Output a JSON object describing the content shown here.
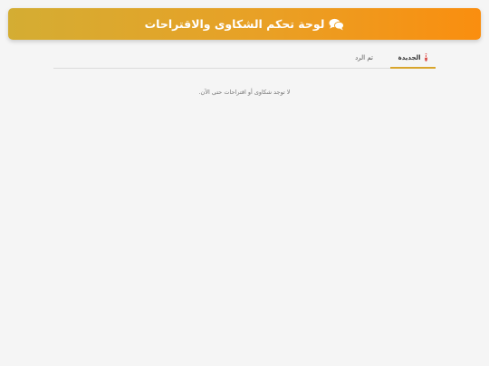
{
  "header": {
    "title": "لوحة تحكم الشكاوى والاقتراحات",
    "icon": "comments-icon",
    "gradient_start": "#d4ad33",
    "gradient_end": "#fa8e0f"
  },
  "tabs": [
    {
      "label": "الجديدة",
      "badge": "0",
      "active": true
    },
    {
      "label": "تم الرد",
      "active": false
    }
  ],
  "empty_state": {
    "message": "لا توجد شكاوى أو اقتراحات حتى الآن."
  },
  "colors": {
    "badge": "#d9534f",
    "active_tab_underline": "#d8a52c",
    "background": "#f5f5f5"
  }
}
